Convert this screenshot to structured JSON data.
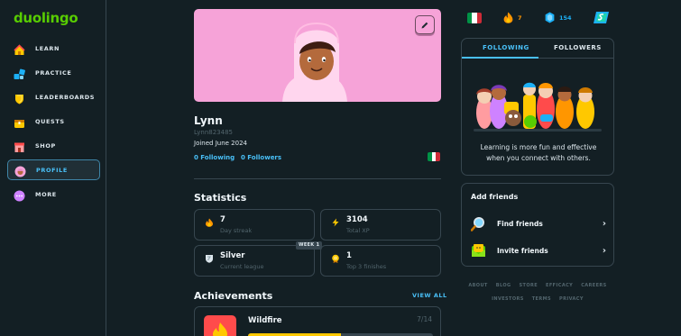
{
  "sidebar": {
    "logo": "duolingo",
    "items": [
      {
        "label": "LEARN",
        "icon": "home-icon"
      },
      {
        "label": "PRACTICE",
        "icon": "practice-icon"
      },
      {
        "label": "LEADERBOARDS",
        "icon": "shield-icon"
      },
      {
        "label": "QUESTS",
        "icon": "chest-icon"
      },
      {
        "label": "SHOP",
        "icon": "shop-icon"
      },
      {
        "label": "PROFILE",
        "icon": "avatar-icon",
        "active": true
      },
      {
        "label": "MORE",
        "icon": "more-icon"
      }
    ]
  },
  "topbar": {
    "course_flag": "italian-flag-icon",
    "streak": "7",
    "gems": "154",
    "super_icon": "super-icon"
  },
  "profile": {
    "name": "Lynn",
    "username": "Lynn823485",
    "joined": "Joined June 2024",
    "following": "0 Following",
    "followers": "0 Followers"
  },
  "statistics": {
    "title": "Statistics",
    "cards": [
      {
        "value": "7",
        "label": "Day streak",
        "icon": "fire-icon"
      },
      {
        "value": "3104",
        "label": "Total XP",
        "icon": "lightning-icon"
      },
      {
        "value": "Silver",
        "label": "Current league",
        "icon": "league-shield-icon",
        "badge": "WEEK 1"
      },
      {
        "value": "1",
        "label": "Top 3 finishes",
        "icon": "medal-icon"
      }
    ]
  },
  "achievements": {
    "title": "Achievements",
    "view_all": "VIEW ALL",
    "items": [
      {
        "name": "Wildfire",
        "count": "7/14",
        "progress": 0.5
      }
    ]
  },
  "friends_panel": {
    "tab_following": "FOLLOWING",
    "tab_followers": "FOLLOWERS",
    "message": "Learning is more fun and effective when you connect with others."
  },
  "add_friends": {
    "title": "Add friends",
    "find": "Find friends",
    "invite": "Invite friends"
  },
  "footer": {
    "row1": [
      "ABOUT",
      "BLOG",
      "STORE",
      "EFFICACY",
      "CAREERS"
    ],
    "row2": [
      "INVESTORS",
      "TERMS",
      "PRIVACY"
    ]
  },
  "colors": {
    "background": "#131f24",
    "accent": "#49c0f8",
    "brand": "#58cc02",
    "border": "#37464f",
    "banner": "#f6a3d8"
  }
}
